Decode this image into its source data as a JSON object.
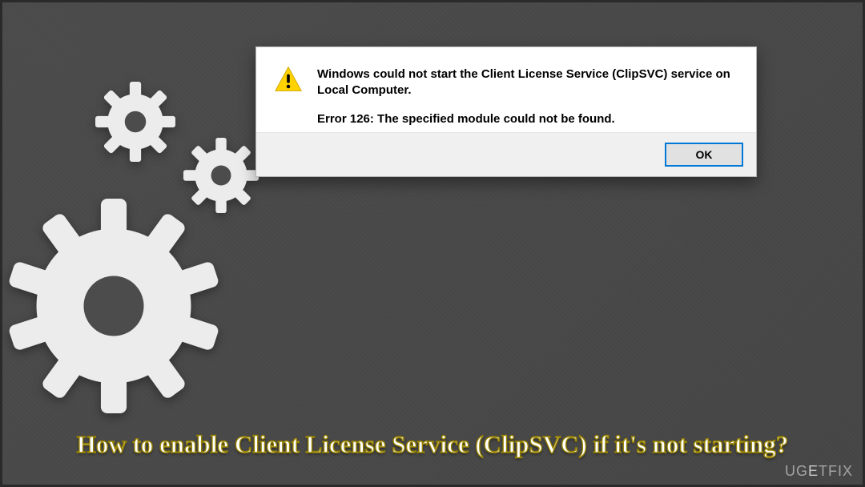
{
  "dialog": {
    "message_line1": "Windows could not start the Client License Service (ClipSVC) service on Local Computer.",
    "message_line2": "Error 126: The specified module could not be found.",
    "ok_label": "OK"
  },
  "caption": {
    "text": "How to enable Client License Service (ClipSVC) if it's not starting?"
  },
  "watermark": {
    "prefix": "UG",
    "mid": "E",
    "suffix": "TFIX"
  },
  "colors": {
    "dialog_bg": "#ffffff",
    "footer_bg": "#f0f0f0",
    "accent": "#0078d7",
    "gear": "#ececec",
    "caption_stroke": "#978200"
  }
}
